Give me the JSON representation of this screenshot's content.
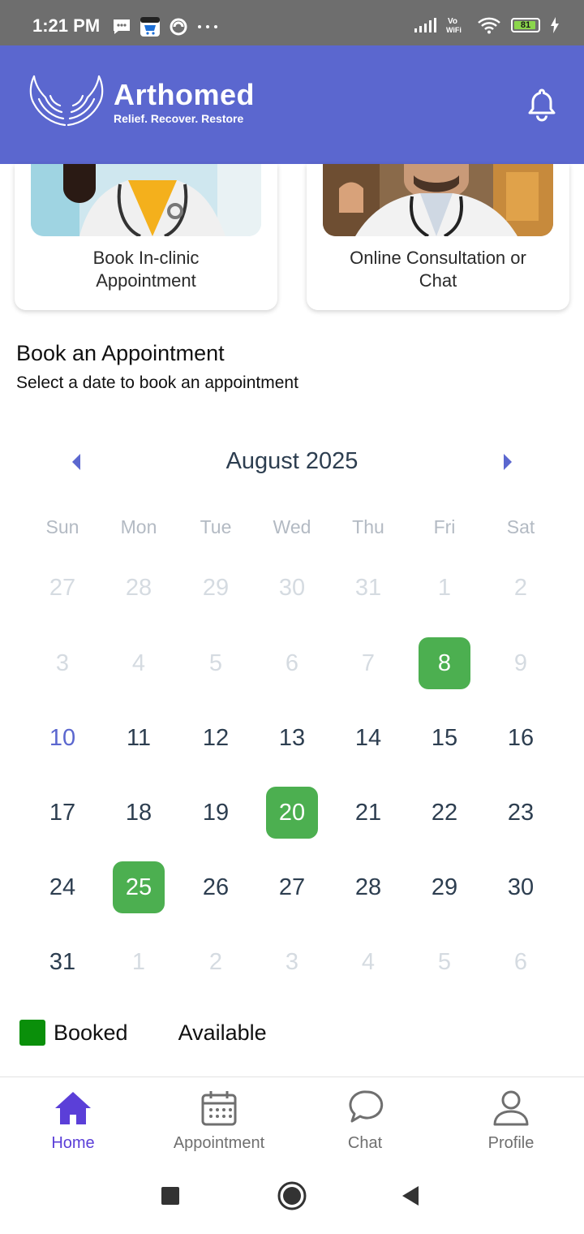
{
  "status_bar": {
    "time": "1:21 PM",
    "battery": "81"
  },
  "header": {
    "brand": "Arthomed",
    "tagline": "Relief. Recover. Restore"
  },
  "services": [
    {
      "label_line1": "Book In-clinic",
      "label_line2": "Appointment"
    },
    {
      "label_line1": "Online Consultation or",
      "label_line2": "Chat"
    }
  ],
  "booking": {
    "title": "Book an Appointment",
    "subtitle": "Select a date to book an appointment"
  },
  "calendar": {
    "month": "August 2025",
    "weekdays": [
      "Sun",
      "Mon",
      "Tue",
      "Wed",
      "Thu",
      "Fri",
      "Sat"
    ],
    "days": [
      "27",
      "28",
      "29",
      "30",
      "31",
      "1",
      "2",
      "3",
      "4",
      "5",
      "6",
      "7",
      "8",
      "9",
      "10",
      "11",
      "12",
      "13",
      "14",
      "15",
      "16",
      "17",
      "18",
      "19",
      "20",
      "21",
      "22",
      "23",
      "24",
      "25",
      "26",
      "27",
      "28",
      "29",
      "30",
      "31",
      "1",
      "2",
      "3",
      "4",
      "5",
      "6"
    ],
    "booked_color": "#4caf50",
    "accent_color": "#5b67cf"
  },
  "legend": {
    "booked": "Booked",
    "available": "Available",
    "booked_color": "#0a8f0a"
  },
  "bottom_nav": [
    {
      "label": "Home",
      "icon": "home-icon",
      "active": true
    },
    {
      "label": "Appointment",
      "icon": "calendar-icon",
      "active": false
    },
    {
      "label": "Chat",
      "icon": "chat-icon",
      "active": false
    },
    {
      "label": "Profile",
      "icon": "profile-icon",
      "active": false
    }
  ]
}
